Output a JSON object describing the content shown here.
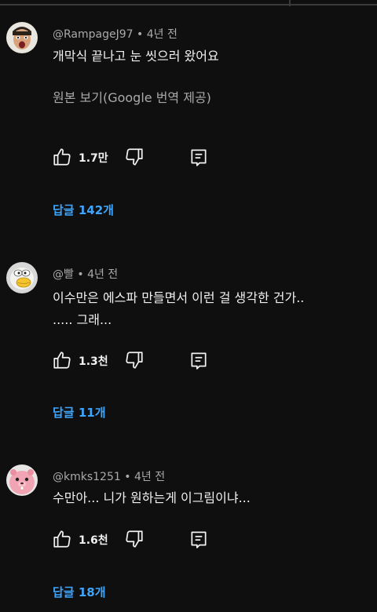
{
  "colors": {
    "background": "#0f0f0f",
    "text": "#f1f1f1",
    "meta": "#aaaaaa",
    "link": "#3ea6ff"
  },
  "comments": [
    {
      "author": "@RampageJ97",
      "time": "4년 전",
      "lines": [
        "개막식 끝나고 눈 씻으러 왔어요"
      ],
      "translate_label": "원본 보기(Google 번역 제공)",
      "likes": "1.7만",
      "replies_label": "답글 142개",
      "avatar_icon": "face-avatar-icon"
    },
    {
      "author": "@빨",
      "time": "4년 전",
      "lines": [
        "이수만은 에스파 만들면서 이런 걸 생각한 건가..",
        "..... 그래..."
      ],
      "likes": "1.3천",
      "replies_label": "답글 11개",
      "avatar_icon": "cartoon-duck-avatar-icon"
    },
    {
      "author": "@kmks1251",
      "time": "4년 전",
      "lines": [
        "수만아... 니가 원하는게 이그림이냐..."
      ],
      "likes": "1.6천",
      "replies_label": "답글 18개",
      "avatar_icon": "pink-beaver-avatar-icon"
    }
  ]
}
